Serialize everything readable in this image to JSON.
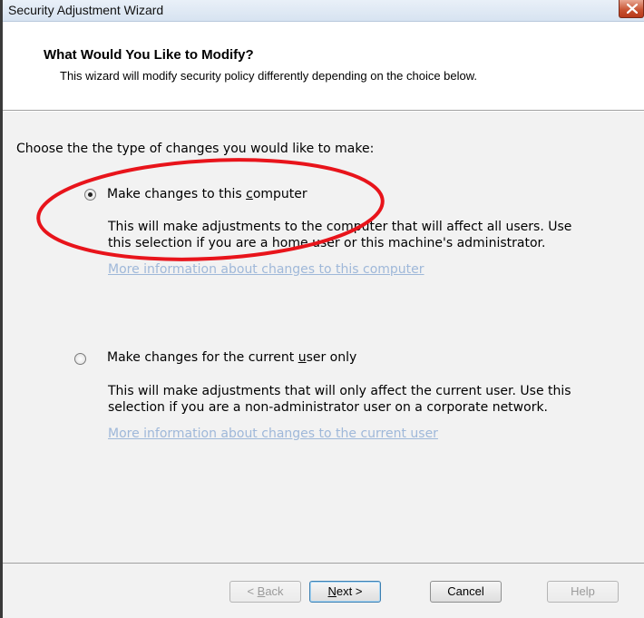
{
  "window": {
    "title": "Security Adjustment Wizard",
    "close_icon": "close-icon"
  },
  "header": {
    "title": "What Would You Like to Modify?",
    "description": "This wizard will modify security policy differently depending on the choice below."
  },
  "main": {
    "prompt": "Choose the the type of changes you would like to make:",
    "options": [
      {
        "label_pre": "Make changes to this ",
        "label_underlined": "c",
        "label_post": "omputer",
        "selected": true,
        "description_line1": "This will make adjustments to the computer that will affect all users.  Use",
        "description_line2": "this selection if you are a home user or this machine's administrator.",
        "link": "More information about changes to this computer"
      },
      {
        "label_pre": "Make changes for the current ",
        "label_underlined": "u",
        "label_post": "ser only",
        "selected": false,
        "description_line1": "This will make adjustments that will only affect the current user.  Use this",
        "description_line2": "selection if you are a non-administrator user on a corporate network.",
        "link": "More information about changes to the current user"
      }
    ]
  },
  "buttons": {
    "back_pre": "< ",
    "back_u": "B",
    "back_post": "ack",
    "next_u": "N",
    "next_post": "ext >",
    "cancel": "Cancel",
    "help": "Help"
  },
  "colors": {
    "annotation_ellipse": "#e8141b",
    "link": "#9fb8d9"
  }
}
